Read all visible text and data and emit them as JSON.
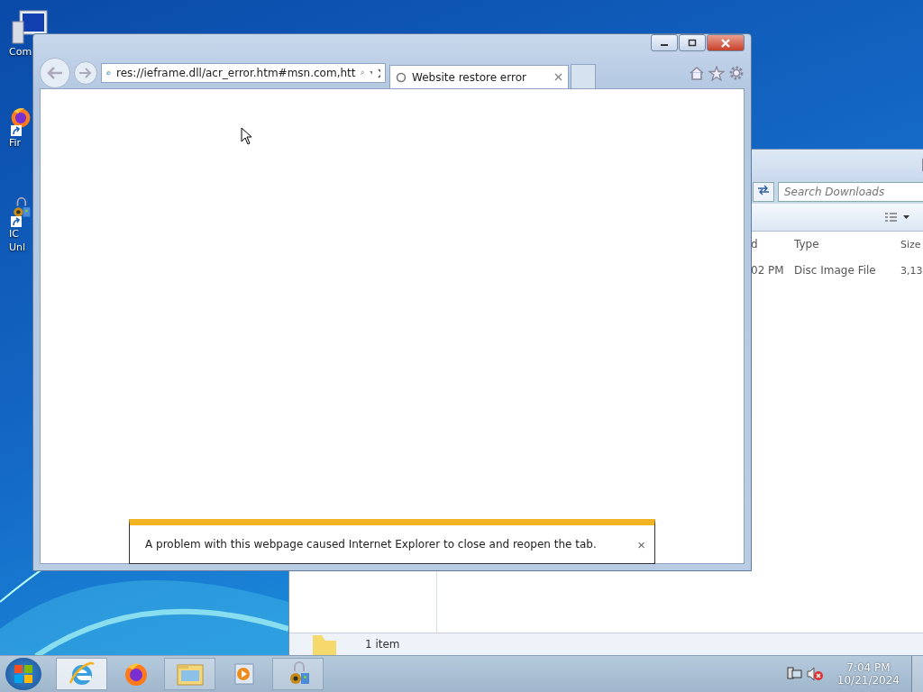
{
  "desktop_icons": [
    {
      "kind": "computer",
      "lines": [
        "Com"
      ]
    },
    {
      "kind": "firefox",
      "lines": [
        "Fir"
      ]
    },
    {
      "kind": "tool",
      "lines": [
        "IC",
        "Unl"
      ]
    }
  ],
  "explorer": {
    "search": {
      "placeholder": "Search Downloads"
    },
    "columns": [
      "d",
      "Type",
      "Size"
    ],
    "rows": [
      [
        "02 PM",
        "Disc Image File",
        "3,13"
      ]
    ],
    "status": "1 item"
  },
  "browser": {
    "address": "res://ieframe.dll/acr_error.htm#msn.com,htt",
    "tabs": [
      {
        "title": "Website restore error",
        "selected": true
      }
    ],
    "notification": {
      "message": "A problem with this webpage caused Internet Explorer to close and reopen the tab.",
      "close": "×"
    }
  },
  "taskbar": {
    "items": [
      {
        "kind": "ie",
        "running": true,
        "selected": true
      },
      {
        "kind": "firefox",
        "running": false,
        "selected": false
      },
      {
        "kind": "explorer",
        "running": true,
        "selected": false
      },
      {
        "kind": "media",
        "running": false,
        "selected": false
      },
      {
        "kind": "tool",
        "running": true,
        "selected": false
      }
    ],
    "clock": {
      "time": "7:04 PM",
      "date": "10/21/2024"
    }
  }
}
